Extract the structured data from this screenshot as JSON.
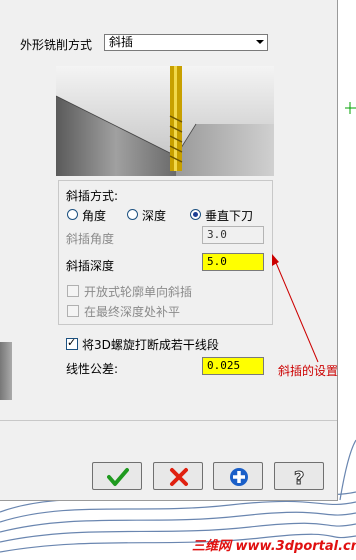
{
  "dialog": {
    "method_label": "外形铣削方式",
    "method_value": "斜插"
  },
  "ramp": {
    "group_title": "斜插方式:",
    "options": [
      "角度",
      "深度",
      "垂直下刀"
    ],
    "selected": "垂直下刀",
    "angle_label": "斜插角度",
    "angle_value": "3.0",
    "depth_label": "斜插深度",
    "depth_value": "5.0",
    "open_contour_label": "开放式轮廓单向斜插",
    "final_depth_label": "在最终深度处补平"
  },
  "helix": {
    "break_label": "将3D螺旋打断成若干线段",
    "break_checked": true,
    "tolerance_label": "线性公差:",
    "tolerance_value": "0.025"
  },
  "annotation": {
    "text": "斜插的设置",
    "color": "#cc0000"
  },
  "buttons": {
    "ok": "check-icon",
    "cancel": "cross-icon",
    "add": "plus-icon",
    "help": "question-icon"
  },
  "watermark": "三维网 www.3dportal.cn"
}
